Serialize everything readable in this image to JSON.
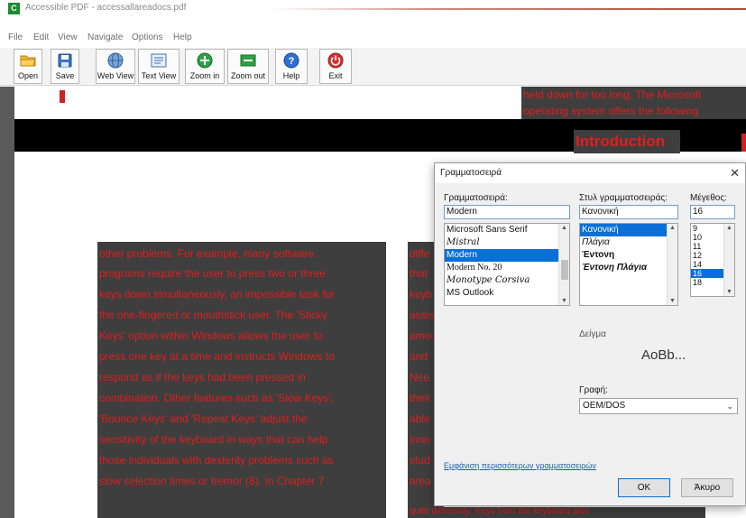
{
  "window": {
    "title": "Accessible PDF - accessallareadocs.pdf",
    "app_icon_letter": "C",
    "accent_color": "#b04a3a"
  },
  "menu": [
    "File",
    "Edit",
    "View",
    "Navigate",
    "Options",
    "Help"
  ],
  "toolbar": {
    "buttons": [
      {
        "label": "Open",
        "icon": "folder-open-icon"
      },
      {
        "label": "Save",
        "icon": "floppy-disk-icon"
      },
      {
        "label": "Web View",
        "icon": "globe-icon"
      },
      {
        "label": "Text View",
        "icon": "text-document-icon"
      },
      {
        "label": "Zoom in",
        "icon": "zoom-in-plus-icon"
      },
      {
        "label": "Zoom out",
        "icon": "zoom-out-minus-icon"
      },
      {
        "label": "Help",
        "icon": "help-question-icon"
      },
      {
        "label": "Exit",
        "icon": "exit-power-icon"
      }
    ]
  },
  "document": {
    "top_right_lines": [
      "held down for too long. The Microsoft",
      "operating system offers the following"
    ],
    "heading": "Introduction",
    "left_column_lines": [
      "other problems. For example, many software",
      "programs require the user to press two or three",
      "keys down simultaneously, an impossible task for",
      "the one-fingered or mouthstick user. The 'Sticky",
      "Keys' option within Windows allows the user to",
      "press one key at a time and instructs Windows to",
      "respond as if the keys had been pressed in",
      "combination. Other features such as 'Slow Keys',",
      "'Bounce Keys' and 'Repeat Keys' adjust the",
      "sensitivity of the keyboard in ways that can help",
      "those individuals with dexterity problems such as",
      "slow selection times or tremor (8). In Chapter 7"
    ],
    "right_column_lines": [
      "diffe",
      "that",
      "keyb",
      "assis",
      "amou",
      "and",
      "Nee",
      "their",
      "able",
      "inno",
      "stud",
      "area"
    ],
    "bottom_line": "quite differently. Keys from the keyboard also",
    "text_color": "#e01e1e",
    "block_color": "#3e3e3e"
  },
  "font_dialog": {
    "title": "Γραμματοσειρά",
    "font_label": "Γραμματοσειρά:",
    "font_value": "Modern",
    "font_list": [
      "Microsoft Sans Serif",
      "Mistral",
      "Modern",
      "Modern No. 20",
      "Monotype Corsiva",
      "MS Outlook"
    ],
    "font_selected": "Modern",
    "style_label": "Στυλ γραμματοσειράς:",
    "style_value": "Κανονική",
    "style_list": [
      "Κανονική",
      "Πλάγια",
      "Έντονη",
      "Έντονη Πλάγια"
    ],
    "style_selected": "Κανονική",
    "size_label": "Μέγεθος:",
    "size_value": "16",
    "size_list": [
      "9",
      "10",
      "11",
      "12",
      "14",
      "16",
      "18"
    ],
    "size_selected": "16",
    "sample_label": "Δείγμα",
    "sample_text": "AoBb...",
    "script_label": "Γραφή:",
    "script_value": "OEM/DOS",
    "more_fonts_link": "Εμφάνιση περισσότερων γραμματοσειρών",
    "ok_label": "OK",
    "cancel_label": "Άκυρο"
  }
}
